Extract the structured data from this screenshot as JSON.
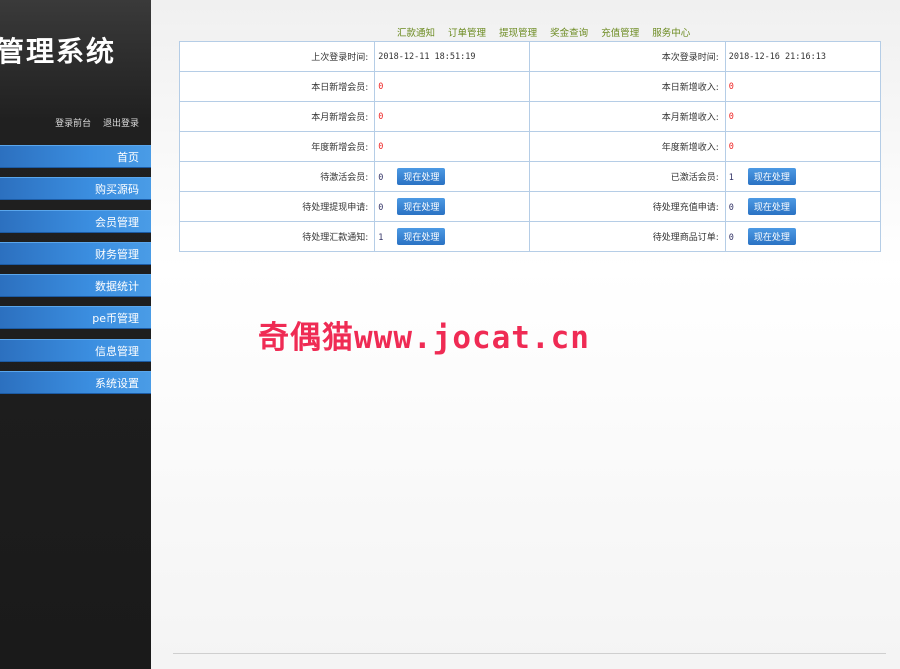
{
  "sidebar": {
    "title": "管理系统",
    "links": [
      "登录前台",
      "退出登录"
    ],
    "menu": [
      "首页",
      "购买源码",
      "会员管理",
      "财务管理",
      "数据统计",
      "pe币管理",
      "信息管理",
      "系统设置"
    ]
  },
  "topnav": [
    "汇款通知",
    "订单管理",
    "提现管理",
    "奖金查询",
    "充值管理",
    "服务中心"
  ],
  "info": {
    "last_login_label": "上次登录时间:",
    "last_login_value": "2018-12-11 18:51:19",
    "this_login_label": "本次登录时间:",
    "this_login_value": "2018-12-16 21:16:13",
    "today_members_label": "本日新增会员:",
    "today_members_value": "0",
    "today_income_label": "本日新增收入:",
    "today_income_value": "0",
    "month_members_label": "本月新增会员:",
    "month_members_value": "0",
    "month_income_label": "本月新增收入:",
    "month_income_value": "0",
    "year_members_label": "年度新增会员:",
    "year_members_value": "0",
    "year_income_label": "年度新增收入:",
    "year_income_value": "0",
    "pending_activate_label": "待激活会员:",
    "pending_activate_value": "0",
    "activated_label": "已激活会员:",
    "activated_value": "1",
    "pending_withdraw_label": "待处理提现申请:",
    "pending_withdraw_value": "0",
    "pending_recharge_label": "待处理充值申请:",
    "pending_recharge_value": "0",
    "pending_remit_label": "待处理汇款通知:",
    "pending_remit_value": "1",
    "pending_order_label": "待处理商品订单:",
    "pending_order_value": "0",
    "process_button": "现在处理"
  },
  "watermark": "奇偶猫www.jocat.cn"
}
